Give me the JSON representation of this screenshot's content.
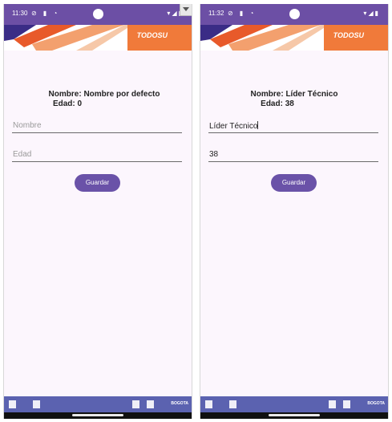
{
  "screens": {
    "left": {
      "status_time": "11:30",
      "name_line": "Nombre: Nombre por defecto",
      "age_line": "Edad: 0",
      "name_placeholder": "Nombre",
      "age_placeholder": "Edad",
      "button_label": "Guardar"
    },
    "right": {
      "status_time": "11:32",
      "name_line": "Nombre: Líder Técnico",
      "age_line": "Edad: 38",
      "name_value": "Líder Técnico",
      "age_value": "38",
      "button_label": "Guardar"
    }
  },
  "banner": {
    "brand": "TODOS",
    "brand_suffix": "U"
  },
  "footer": {
    "city_label": "BOGOTA"
  },
  "colors": {
    "primary": "#6a52a8",
    "status_bar": "#6c4fa5",
    "footer": "#5b62b0",
    "banner_orange": "#f07a3a",
    "background": "#fcf6fd"
  },
  "icons": [
    "wifi-icon",
    "signal-icon",
    "battery-icon",
    "notification-icons",
    "camera-cutout",
    "dropdown-arrow-icon"
  ]
}
